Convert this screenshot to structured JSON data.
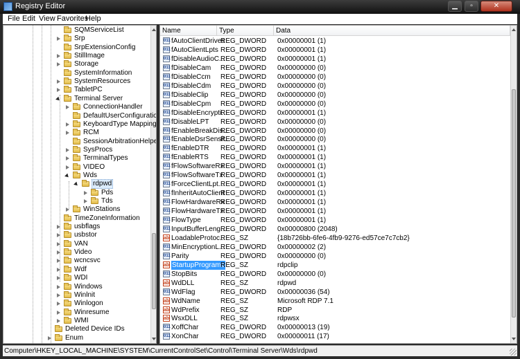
{
  "window": {
    "title": "Registry Editor"
  },
  "menu": [
    "File",
    "Edit",
    "View",
    "Favorites",
    "Help"
  ],
  "tree": [
    {
      "label": "SQMServiceList",
      "depth": 3,
      "expander": "none",
      "sel": false
    },
    {
      "label": "Srp",
      "depth": 3,
      "expander": "collapsed",
      "sel": false
    },
    {
      "label": "SrpExtensionConfig",
      "depth": 3,
      "expander": "none",
      "sel": false
    },
    {
      "label": "StillImage",
      "depth": 3,
      "expander": "collapsed",
      "sel": false
    },
    {
      "label": "Storage",
      "depth": 3,
      "expander": "collapsed",
      "sel": false
    },
    {
      "label": "SystemInformation",
      "depth": 3,
      "expander": "none",
      "sel": false
    },
    {
      "label": "SystemResources",
      "depth": 3,
      "expander": "collapsed",
      "sel": false
    },
    {
      "label": "TabletPC",
      "depth": 3,
      "expander": "collapsed",
      "sel": false
    },
    {
      "label": "Terminal Server",
      "depth": 3,
      "expander": "expanded",
      "sel": false
    },
    {
      "label": "ConnectionHandler",
      "depth": 4,
      "expander": "collapsed",
      "sel": false
    },
    {
      "label": "DefaultUserConfiguration",
      "depth": 4,
      "expander": "none",
      "sel": false
    },
    {
      "label": "KeyboardType Mapping",
      "depth": 4,
      "expander": "collapsed",
      "sel": false
    },
    {
      "label": "RCM",
      "depth": 4,
      "expander": "collapsed",
      "sel": false
    },
    {
      "label": "SessionArbitrationHelper",
      "depth": 4,
      "expander": "none",
      "sel": false
    },
    {
      "label": "SysProcs",
      "depth": 4,
      "expander": "collapsed",
      "sel": false
    },
    {
      "label": "TerminalTypes",
      "depth": 4,
      "expander": "collapsed",
      "sel": false
    },
    {
      "label": "VIDEO",
      "depth": 4,
      "expander": "collapsed",
      "sel": false
    },
    {
      "label": "Wds",
      "depth": 4,
      "expander": "expanded",
      "sel": false
    },
    {
      "label": "rdpwd",
      "depth": 5,
      "expander": "expanded",
      "sel": true
    },
    {
      "label": "Pds",
      "depth": 6,
      "expander": "collapsed",
      "sel": false
    },
    {
      "label": "Tds",
      "depth": 6,
      "expander": "collapsed",
      "sel": false
    },
    {
      "label": "WinStations",
      "depth": 4,
      "expander": "collapsed",
      "sel": false
    },
    {
      "label": "TimeZoneInformation",
      "depth": 3,
      "expander": "none",
      "sel": false
    },
    {
      "label": "usbflags",
      "depth": 3,
      "expander": "collapsed",
      "sel": false
    },
    {
      "label": "usbstor",
      "depth": 3,
      "expander": "collapsed",
      "sel": false
    },
    {
      "label": "VAN",
      "depth": 3,
      "expander": "collapsed",
      "sel": false
    },
    {
      "label": "Video",
      "depth": 3,
      "expander": "collapsed",
      "sel": false
    },
    {
      "label": "wcncsvc",
      "depth": 3,
      "expander": "collapsed",
      "sel": false
    },
    {
      "label": "Wdf",
      "depth": 3,
      "expander": "collapsed",
      "sel": false
    },
    {
      "label": "WDI",
      "depth": 3,
      "expander": "collapsed",
      "sel": false
    },
    {
      "label": "Windows",
      "depth": 3,
      "expander": "collapsed",
      "sel": false
    },
    {
      "label": "Winlnit",
      "depth": 3,
      "expander": "collapsed",
      "sel": false
    },
    {
      "label": "Winlogon",
      "depth": 3,
      "expander": "collapsed",
      "sel": false
    },
    {
      "label": "Winresume",
      "depth": 3,
      "expander": "collapsed",
      "sel": false
    },
    {
      "label": "WMI",
      "depth": 3,
      "expander": "collapsed",
      "sel": false
    },
    {
      "label": "Deleted Device IDs",
      "depth": 2,
      "expander": "none",
      "sel": false
    },
    {
      "label": "Enum",
      "depth": 2,
      "expander": "collapsed",
      "sel": false
    }
  ],
  "columns": {
    "name": "Name",
    "type": "Type",
    "data": "Data"
  },
  "values": [
    {
      "icon": "dword",
      "name": "fAutoClientDrives",
      "type": "REG_DWORD",
      "data": "0x00000001 (1)"
    },
    {
      "icon": "dword",
      "name": "fAutoClientLpts",
      "type": "REG_DWORD",
      "data": "0x00000001 (1)"
    },
    {
      "icon": "dword",
      "name": "fDisableAudioC...",
      "type": "REG_DWORD",
      "data": "0x00000001 (1)"
    },
    {
      "icon": "dword",
      "name": "fDisableCam",
      "type": "REG_DWORD",
      "data": "0x00000000 (0)"
    },
    {
      "icon": "dword",
      "name": "fDisableCcm",
      "type": "REG_DWORD",
      "data": "0x00000000 (0)"
    },
    {
      "icon": "dword",
      "name": "fDisableCdm",
      "type": "REG_DWORD",
      "data": "0x00000000 (0)"
    },
    {
      "icon": "dword",
      "name": "fDisableClip",
      "type": "REG_DWORD",
      "data": "0x00000000 (0)"
    },
    {
      "icon": "dword",
      "name": "fDisableCpm",
      "type": "REG_DWORD",
      "data": "0x00000000 (0)"
    },
    {
      "icon": "dword",
      "name": "fDisableEncrypti...",
      "type": "REG_DWORD",
      "data": "0x00000001 (1)"
    },
    {
      "icon": "dword",
      "name": "fDisableLPT",
      "type": "REG_DWORD",
      "data": "0x00000000 (0)"
    },
    {
      "icon": "dword",
      "name": "fEnableBreakDis...",
      "type": "REG_DWORD",
      "data": "0x00000000 (0)"
    },
    {
      "icon": "dword",
      "name": "fEnableDsrSensit...",
      "type": "REG_DWORD",
      "data": "0x00000000 (0)"
    },
    {
      "icon": "dword",
      "name": "fEnableDTR",
      "type": "REG_DWORD",
      "data": "0x00000001 (1)"
    },
    {
      "icon": "dword",
      "name": "fEnableRTS",
      "type": "REG_DWORD",
      "data": "0x00000001 (1)"
    },
    {
      "icon": "dword",
      "name": "fFlowSoftwareRx",
      "type": "REG_DWORD",
      "data": "0x00000001 (1)"
    },
    {
      "icon": "dword",
      "name": "fFlowSoftwareTx",
      "type": "REG_DWORD",
      "data": "0x00000001 (1)"
    },
    {
      "icon": "dword",
      "name": "fForceClientLpt...",
      "type": "REG_DWORD",
      "data": "0x00000001 (1)"
    },
    {
      "icon": "dword",
      "name": "fInheritAutoClient",
      "type": "REG_DWORD",
      "data": "0x00000001 (1)"
    },
    {
      "icon": "dword",
      "name": "FlowHardwareRx",
      "type": "REG_DWORD",
      "data": "0x00000001 (1)"
    },
    {
      "icon": "dword",
      "name": "FlowHardwareTx",
      "type": "REG_DWORD",
      "data": "0x00000001 (1)"
    },
    {
      "icon": "dword",
      "name": "FlowType",
      "type": "REG_DWORD",
      "data": "0x00000001 (1)"
    },
    {
      "icon": "dword",
      "name": "InputBufferLeng...",
      "type": "REG_DWORD",
      "data": "0x00000800 (2048)"
    },
    {
      "icon": "sz",
      "name": "LoadableProtoc...",
      "type": "REG_SZ",
      "data": "{18b726bb-6fe6-4fb9-9276-ed57ce7c7cb2}"
    },
    {
      "icon": "dword",
      "name": "MinEncryptionL...",
      "type": "REG_DWORD",
      "data": "0x00000002 (2)"
    },
    {
      "icon": "dword",
      "name": "Parity",
      "type": "REG_DWORD",
      "data": "0x00000000 (0)"
    },
    {
      "icon": "sz",
      "name": "StartupPrograms",
      "type": "REG_SZ",
      "data": "rdpclip",
      "sel": true
    },
    {
      "icon": "dword",
      "name": "StopBits",
      "type": "REG_DWORD",
      "data": "0x00000000 (0)"
    },
    {
      "icon": "sz",
      "name": "WdDLL",
      "type": "REG_SZ",
      "data": "rdpwd"
    },
    {
      "icon": "dword",
      "name": "WdFlag",
      "type": "REG_DWORD",
      "data": "0x00000036 (54)"
    },
    {
      "icon": "sz",
      "name": "WdName",
      "type": "REG_SZ",
      "data": "Microsoft RDP 7.1"
    },
    {
      "icon": "sz",
      "name": "WdPrefix",
      "type": "REG_SZ",
      "data": "RDP"
    },
    {
      "icon": "sz",
      "name": "WsxDLL",
      "type": "REG_SZ",
      "data": "rdpwsx"
    },
    {
      "icon": "dword",
      "name": "XoffChar",
      "type": "REG_DWORD",
      "data": "0x00000013 (19)"
    },
    {
      "icon": "dword",
      "name": "XonChar",
      "type": "REG_DWORD",
      "data": "0x00000011 (17)"
    }
  ],
  "status": {
    "path": "Computer\\HKEY_LOCAL_MACHINE\\SYSTEM\\CurrentControlSet\\Control\\Terminal Server\\Wds\\rdpwd"
  },
  "colors": {
    "selection": "#3399ff",
    "tree_selection": "#dcecfc",
    "titlebar": "#1a1a1a"
  }
}
